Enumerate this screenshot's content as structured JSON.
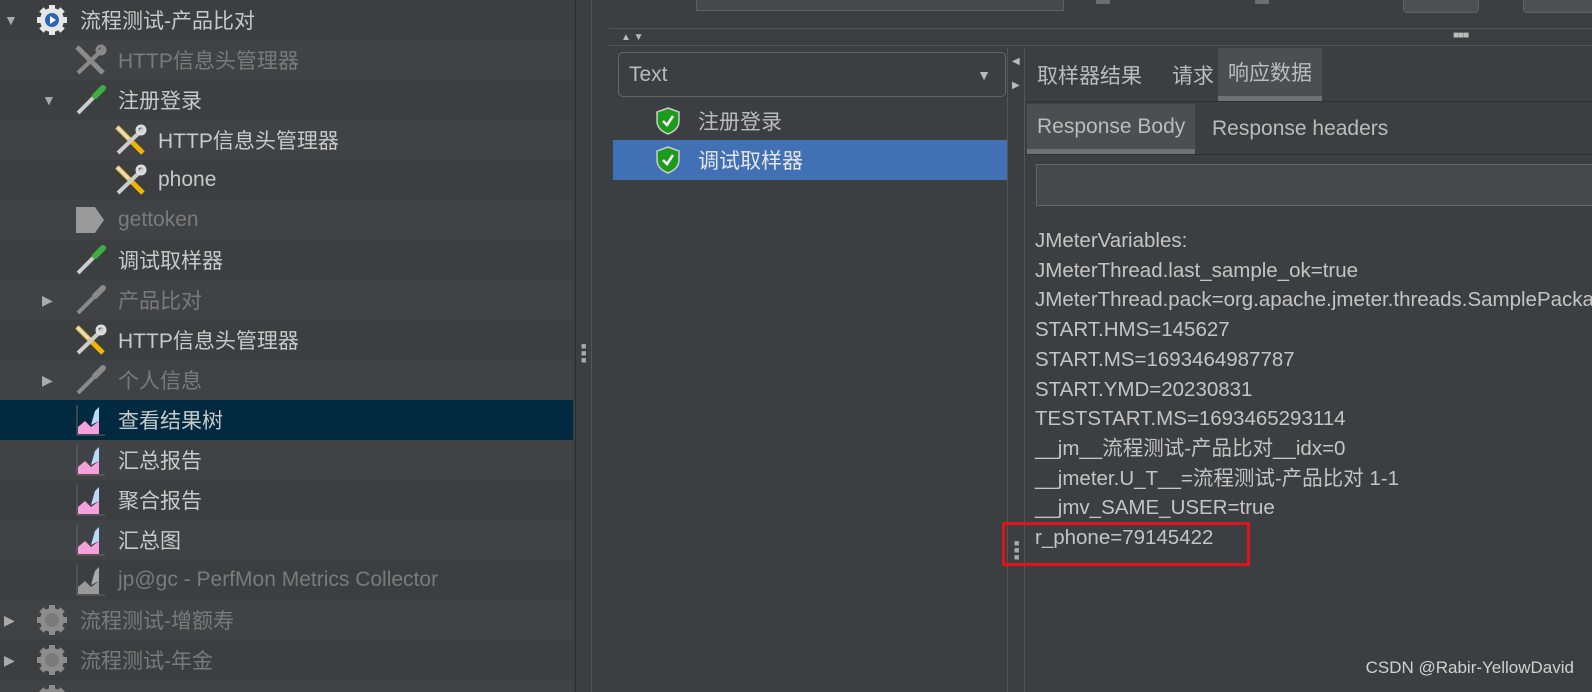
{
  "tree": [
    {
      "label": "流程测试-产品比对",
      "level": 0,
      "icon": "thread-group-gear-icon",
      "expander": "expanded",
      "disabled": false
    },
    {
      "label": "HTTP信息头管理器",
      "level": 2,
      "icon": "config-tools-icon",
      "expander": "none",
      "disabled": true
    },
    {
      "label": "注册登录",
      "level": 2,
      "icon": "sampler-pipette-icon",
      "expander": "expanded",
      "disabled": false
    },
    {
      "label": "HTTP信息头管理器",
      "level": 3,
      "icon": "config-tools-icon",
      "expander": "none",
      "disabled": false
    },
    {
      "label": "phone",
      "level": 3,
      "icon": "config-tools-icon",
      "expander": "none",
      "disabled": false
    },
    {
      "label": "gettoken",
      "level": 2,
      "icon": "post-processor-icon",
      "expander": "none",
      "disabled": true
    },
    {
      "label": "调试取样器",
      "level": 2,
      "icon": "sampler-pipette-icon",
      "expander": "none",
      "disabled": false
    },
    {
      "label": "产品比对",
      "level": 2,
      "icon": "sampler-pipette-icon",
      "expander": "collapsed",
      "disabled": true
    },
    {
      "label": "HTTP信息头管理器",
      "level": 2,
      "icon": "config-tools-icon",
      "expander": "none",
      "disabled": false
    },
    {
      "label": "个人信息",
      "level": 2,
      "icon": "sampler-pipette-icon",
      "expander": "collapsed",
      "disabled": true
    },
    {
      "label": "查看结果树",
      "level": 2,
      "icon": "listener-graph-icon",
      "expander": "none",
      "disabled": false,
      "selected": true
    },
    {
      "label": "汇总报告",
      "level": 2,
      "icon": "listener-graph-icon",
      "expander": "none",
      "disabled": false
    },
    {
      "label": "聚合报告",
      "level": 2,
      "icon": "listener-graph-icon",
      "expander": "none",
      "disabled": false
    },
    {
      "label": "汇总图",
      "level": 2,
      "icon": "listener-graph-icon",
      "expander": "none",
      "disabled": false
    },
    {
      "label": "jp@gc - PerfMon Metrics Collector",
      "level": 2,
      "icon": "listener-graph-icon",
      "expander": "none",
      "disabled": true
    },
    {
      "label": "流程测试-增额寿",
      "level": 0,
      "icon": "thread-group-gear-icon",
      "expander": "collapsed",
      "disabled": true
    },
    {
      "label": "流程测试-年金",
      "level": 0,
      "icon": "thread-group-gear-icon",
      "expander": "collapsed",
      "disabled": true
    },
    {
      "label": "",
      "level": 0,
      "icon": "thread-group-gear-icon",
      "expander": "collapsed",
      "disabled": true
    }
  ],
  "results": {
    "renderer": "Text",
    "items": [
      {
        "label": "注册登录",
        "status": "success",
        "selected": false
      },
      {
        "label": "调试取样器",
        "status": "success",
        "selected": true
      }
    ]
  },
  "tabs": [
    {
      "label": "取样器结果",
      "active": false
    },
    {
      "label": "请求",
      "active": false
    },
    {
      "label": "响应数据",
      "active": true
    }
  ],
  "subtabs": [
    {
      "label": "Response Body",
      "active": true
    },
    {
      "label": "Response headers",
      "active": false
    }
  ],
  "search_value": "",
  "response_body": [
    "JMeterVariables:",
    "JMeterThread.last_sample_ok=true",
    "JMeterThread.pack=org.apache.jmeter.threads.SamplePackage@...",
    "START.HMS=145627",
    "START.MS=1693464987787",
    "START.YMD=20230831",
    "TESTSTART.MS=1693465293114",
    "__jm__流程测试-产品比对__idx=0",
    "__jmeter.U_T__=流程测试-产品比对 1-1",
    "__jmv_SAME_USER=true",
    "r_phone=79145422"
  ],
  "highlight_color": "#e0131c",
  "selection_color": "#4170b5",
  "watermark": "CSDN @Rabir-YellowDavid"
}
